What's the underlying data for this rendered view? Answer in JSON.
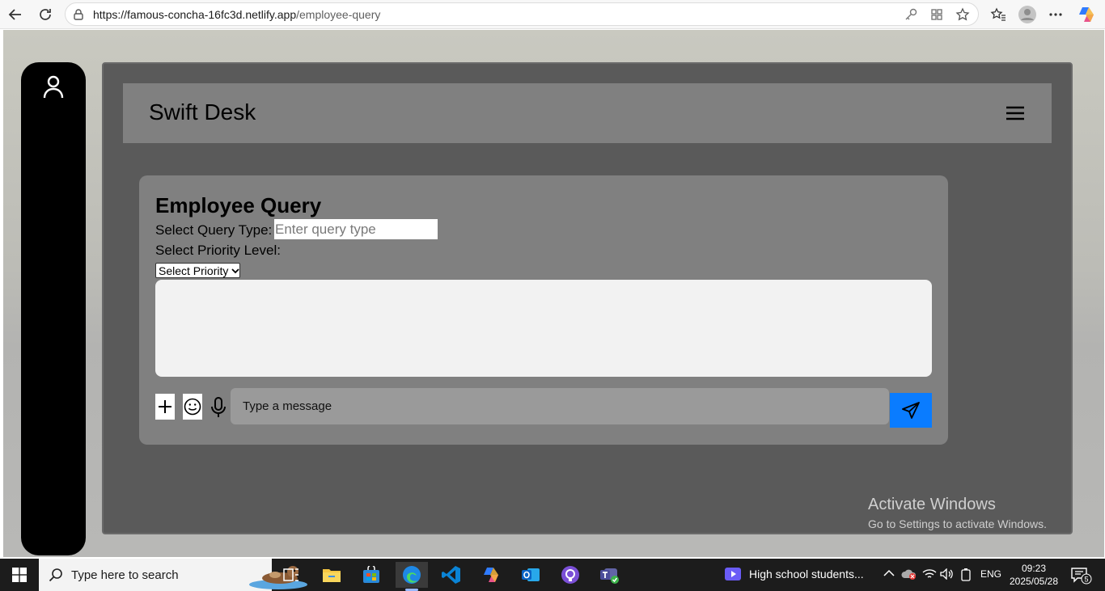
{
  "browser": {
    "url_host": "https://famous-concha-16fc3d.netlify.app",
    "url_path": "/employee-query"
  },
  "app": {
    "title": "Swift Desk"
  },
  "query_form": {
    "heading": "Employee Query",
    "query_type_label": "Select Query Type:",
    "query_type_placeholder": "Enter query type",
    "priority_label": "Select Priority Level:",
    "priority_selected": "Select Priority",
    "message_placeholder": "Type a message"
  },
  "watermark": {
    "line1": "Activate Windows",
    "line2": "Go to Settings to activate Windows."
  },
  "taskbar": {
    "search_placeholder": "Type here to search",
    "news_text": "High school students...",
    "language": "ENG",
    "time": "09:23",
    "date": "2025/05/28",
    "notification_count": "5"
  },
  "colors": {
    "send_button": "#0a7cff",
    "panel": "#5a5a5a",
    "card": "#808080"
  }
}
